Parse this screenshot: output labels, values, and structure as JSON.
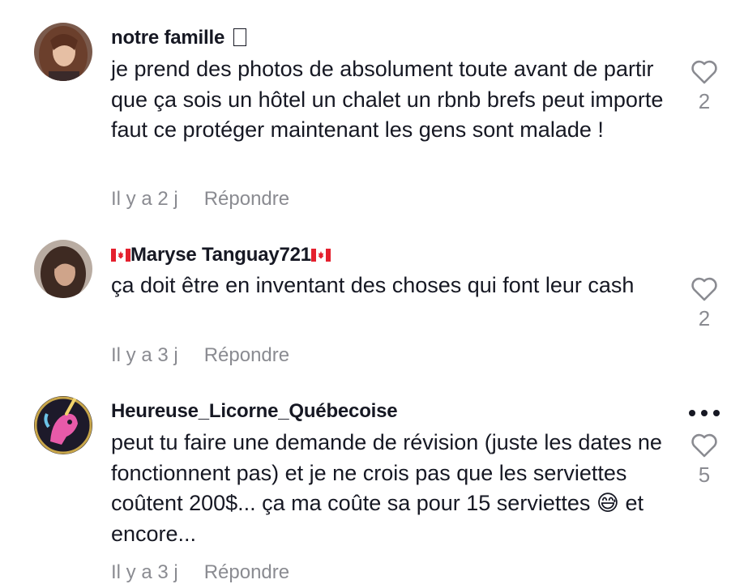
{
  "comments": [
    {
      "username": "notre famille",
      "username_suffix_glyph": "box",
      "text": "je prend des photos de absolument toute avant de partir que ça sois un hôtel un chalet un rbnb brefs peut importe faut ce protéger maintenant les gens sont malade !",
      "time": "Il y a 2 j",
      "reply_label": "Répondre",
      "likes": "2",
      "icons": {
        "like": "heart-outline-icon"
      }
    },
    {
      "username": "Maryse Tanguay721",
      "username_flags": "canada-flag-icon",
      "text": "ça doit être en inventant des choses qui font leur cash",
      "time": "Il y a 3 j",
      "reply_label": "Répondre",
      "likes": "2",
      "icons": {
        "like": "heart-outline-icon"
      }
    },
    {
      "username": "Heureuse_Licorne_Québecoise",
      "text_main": "peut tu faire une demande de révision (juste les dates ne fonctionnent pas) et je ne crois pas que les serviettes coûtent 200$... ça ma coûte sa pour 15 serviettes",
      "text_emoji": "😅",
      "text_tail": " et encore...",
      "time": "Il y a 3 j",
      "reply_label": "Répondre",
      "likes": "5",
      "icons": {
        "like": "heart-outline-icon",
        "more": "more-dots-icon"
      }
    }
  ],
  "colors": {
    "primary_text": "#161823",
    "secondary_text": "#8a8b91",
    "canada_red": "#e4202e"
  }
}
